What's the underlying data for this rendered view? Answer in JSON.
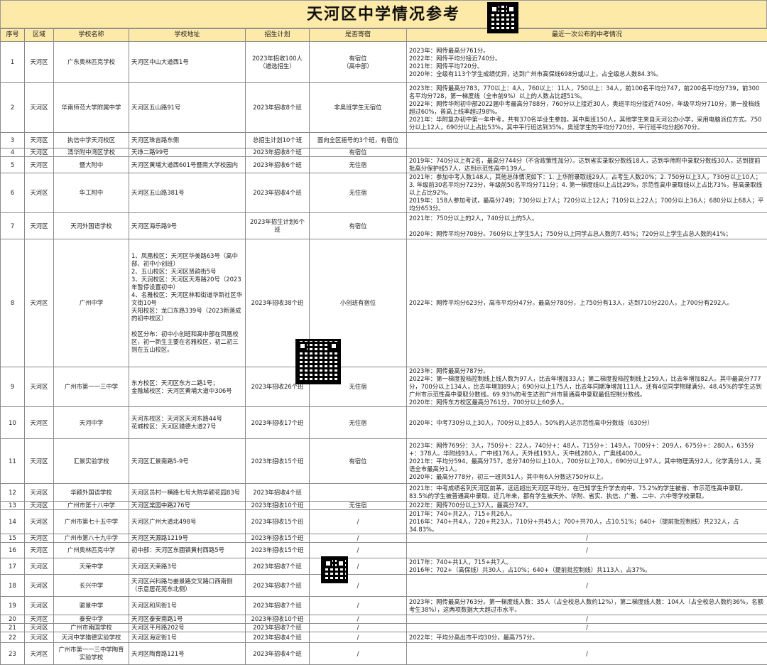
{
  "title": "天河区中学情况参考",
  "columns": [
    "序号",
    "区域",
    "学校名称",
    "学校地址",
    "招生计划",
    "是否寄宿",
    "最近一次公布的中考情况"
  ],
  "rows": [
    {
      "no": "1",
      "area": "天河区",
      "name": "广东奥林匹克学校",
      "addr": "天河区中山大道西1号",
      "plan": "2023年招收100人\n（遴选招生）",
      "board": "有宿位\n（高中部）",
      "result": "2023年：网传最高分761分。\n2022年：网传平均分接近740分。\n2021年：网传平均720分。\n2020年：全级有113个学生成绩优异，达到广州市高保线698分或以上，占全级总人数84.3%。"
    },
    {
      "no": "2",
      "area": "天河区",
      "name": "华南师范大学附属中学",
      "addr": "天河区五山路91号",
      "plan": "2023年招收8个班",
      "board": "非奥班学生无宿位",
      "result": "2023年：网传最高分783，770以上：4人，760以上：11人，750以上：34人，前100名平均分747，前200名平均分739，前300名平均分728，第一梯度线（全市前9%）以上的人数占比超51%。\n2022年：网传华附初中部2022届中考最高分788分，760分以上接近30人，奥班平均分接近740分，年级平均分710分，第一投档线超过60%，普高上线率超过98%。\n2021年：华附复办初中第一年中考，共有370名毕业生参加。其中奥班150人，其他学生来自天河公办小学，采用电脑派位方式。750分以上12人，690分以上占比53%，其中平行班达到35%，奥班学生的平均分720分，平行班平均分超670分。"
    },
    {
      "no": "3",
      "area": "天河区",
      "name": "执信中学天河校区",
      "addr": "天河区珠吉路东侧",
      "plan": "总招生计划10个班",
      "board": "面向全区摇号的3个班，有宿位",
      "result": ""
    },
    {
      "no": "4",
      "area": "天河区",
      "name": "清华附中湾区学校",
      "addr": "天竫二路99号",
      "plan": "2023年招收8个班",
      "board": "有宿位",
      "result": ""
    },
    {
      "no": "5",
      "area": "天河区",
      "name": "暨大附中",
      "addr": "天河区黄埔大道西601号暨南大学校园内",
      "plan": "2023年招收6个班",
      "board": "无住宿",
      "result": "2019年：740分以上有2名，最高分744分（不含政策性加分）。达到省实录取分数线18人，达到华师附中录取分数线30人，达到提前批高分保护线57人，达到示范性高中139人。"
    },
    {
      "no": "6",
      "area": "天河区",
      "name": "华工附中",
      "addr": "天河区五山路381号",
      "plan": "2023年招收4个班",
      "board": "无住宿",
      "result": "2021年：参加中考人数148人，其他总体情况如下：1. 上华附录取线29人，占考生人数20%；2. 750分以上3人，730分以上10人；3. 年级前30名平均分723分，年级前50名平均分711分；4. 第一梯度线以上占比29%，示范性高中录取线以上占比73%，普高录取线以上占比92%。\n2019年：158人参加考试，最高分749；730分以上7人；720分以上12人；710分以上22人；700分以上36人；680分以上68人；平均分653分。"
    },
    {
      "no": "7",
      "area": "天河区",
      "name": "天河外国语学校",
      "addr": "天河区海乐路9号",
      "plan": "2023年招生计划6个班",
      "board": "有宿位",
      "result": "2021年：750分以上的2人，740分以上的5人。\n\n2020年：网传平均分708分。760分以上学生5人；750分以上同学占总人数的7.45%；720分以上学生占总人数的41%；"
    },
    {
      "no": "8",
      "area": "天河区",
      "name": "广州中学",
      "addr": "1、凤凰校区：天河区华美路63号（高中部、初中小创班）\n2、五山校区：天河区贤韵街5号\n3、天润校区：天河区天寿路20号（2023年暂停设置初中）\n4、名雅校区：天河区林和街道华新社区华文街10号\n天阳校区：龙口东路339号（2023新落成的初中校区）\n\n校区分布：初中小创班和高中部在凤凰校区，初一新生主要在名雅校区，初二初三则在五山校区。",
      "plan": "2023年招收38个班",
      "board": "小创班有宿位",
      "result": "2022年：网传平均分623分，高市平均分47分。最高分780分，上750分有13人，达到710分220人，上700分有292人。"
    },
    {
      "no": "9",
      "area": "天河区",
      "name": "广州市第一一三中学",
      "addr": "东方校区：天河区东方二路1号；\n金融城校区：天河区黄埔大道中306号",
      "plan": "2023年招收26个班",
      "board": "无住宿",
      "result": "2023年：网传最高分787分。\n2022年：第一梯度投档控制线上线人数为97人，比去年增加33人；第二梯度投档控制线上259人，比去年增加82人。其中最高分777分，700分以上134人，比去年增加89人；690分以上175人，比去年同期净增加111人。还有4位同学物理满分。48.45%的学生达到广州市示范性高中录取分数线。69.93%的考生达到广州市普通高中录取最低控制分数线。\n2020年：网传东方校区最高分761分，700分以上60多人。"
    },
    {
      "no": "10",
      "area": "天河区",
      "name": "天河中学",
      "addr": "天河东校区：天河区天河东路44号\n花城校区：天河区猎德大道27号",
      "plan": "2023年招收17个班",
      "board": "无住宿",
      "result": "2020年：中考730分以上30人，700分以上85人，50%的人达示范性高中分数线（630分）"
    },
    {
      "no": "11",
      "area": "天河区",
      "name": "汇景实验学校",
      "addr": "天河区汇景南路5-9号",
      "plan": "2023年招收15个班",
      "board": "有宿位",
      "result": "2023年：网传769分：3人，750分+：22人，740分+：48人，715分+：149人，700分+：209人，675分+：280人，635分+：378人。华附线93人，广中线176人，天外线193人，天中线280人，广奥线400人。\n2021年：平均分594，最高分757，总分740分以上10人，700分以上70人，690分以上97人，其中物理满分2人，化学满分1人，英语全市最高分1人。\n2020年：最高分778分，初三一班共51人，其中有6人分数达750分以上。"
    },
    {
      "no": "12",
      "area": "天河区",
      "name": "华颖外国语学校",
      "addr": "天河区员村一横路七号大院华颖花园83号",
      "plan": "2023年招收4个班",
      "board": "",
      "result": "2021年：中考成绩名列天河区前茅，远远超出天河区平均分。在已知学生升学去向中，75.2%的学生被省、市示范性高中录取，83.5%的学生被普通高中录取。近几年来，都有学生被天外、华附、省实、执信、广雅、二中、六中等学校录取。"
    },
    {
      "no": "13",
      "area": "天河区",
      "name": "广州市第十八中学",
      "addr": "天河区棠园中路276号",
      "plan": "2023年招收10个班",
      "board": "无住宿",
      "result": "2022年：网传700分以上37人，最高分747。"
    },
    {
      "no": "14",
      "area": "天河区",
      "name": "广州市第七十五中学",
      "addr": "天河区广州大道北498号",
      "plan": "2023年招收15个班",
      "board": "/",
      "result": "2017年：740+共2人，715+共26人。\n2016年：740+共4人，720+共23人，710分+共45人；700+共70人，占10.51%；640+（提前批控制线）共232人，占34.83%。"
    },
    {
      "no": "15",
      "area": "天河区",
      "name": "广州市第八十九中学",
      "addr": "天河区天源路1219号",
      "plan": "2023年招收15个班",
      "board": "/",
      "result": "/"
    },
    {
      "no": "16",
      "area": "天河区",
      "name": "广州奥林匹克中学",
      "addr": "初中部：天河区东圃镇黄村西路5号",
      "plan": "2023年招收15个班",
      "board": "/",
      "result": "/"
    },
    {
      "no": "17",
      "area": "天河区",
      "name": "天荣中学",
      "addr": "天河区天荣路3号",
      "plan": "2023年招收7个班",
      "board": "/",
      "result": "2017年：740+共1人，715+共7人。\n2016年：702+（高保线）共30人，占10%；640+（提前批控制线）共113人，占37%。"
    },
    {
      "no": "18",
      "area": "天河区",
      "name": "长兴中学",
      "addr": "天河区兴科路与姜景路交叉路口西南侧（乐意居花苑东北侧）",
      "plan": "2023年招收7个班",
      "board": "/",
      "result": "/"
    },
    {
      "no": "19",
      "area": "天河区",
      "name": "骏景中学",
      "addr": "天河区和风街1号",
      "plan": "2023年招收7个班",
      "board": "/",
      "result": "2023年：网传最高分763分。第一梯度线人数：35人（占全校总人数约12%），第二梯度线人数：104人（占全校总人数约36%，名额考生38%），这两项数据大大超过市水平。"
    },
    {
      "no": "20",
      "area": "天河区",
      "name": "泰安中学",
      "addr": "天河区泰安南路1号",
      "plan": "2023年招收10个班",
      "board": "/",
      "result": "/"
    },
    {
      "no": "21",
      "area": "天河区",
      "name": "广州市南国学校",
      "addr": "天河区平月路202号",
      "plan": "2023年招收7个班",
      "board": "/",
      "result": "/"
    },
    {
      "no": "22",
      "area": "天河区",
      "name": "天河中学猎德实验学校",
      "addr": "天河区海定街1号",
      "plan": "2023年招收4个班",
      "board": "/",
      "result": "2022年：平均分高出市平均30分，最高757分。"
    },
    {
      "no": "23",
      "area": "天河区",
      "name": "广州市第一一三中学陶育实验学校",
      "addr": "天河区陶育路121号",
      "plan": "2023年招收4个班",
      "board": "/",
      "result": "/"
    }
  ]
}
